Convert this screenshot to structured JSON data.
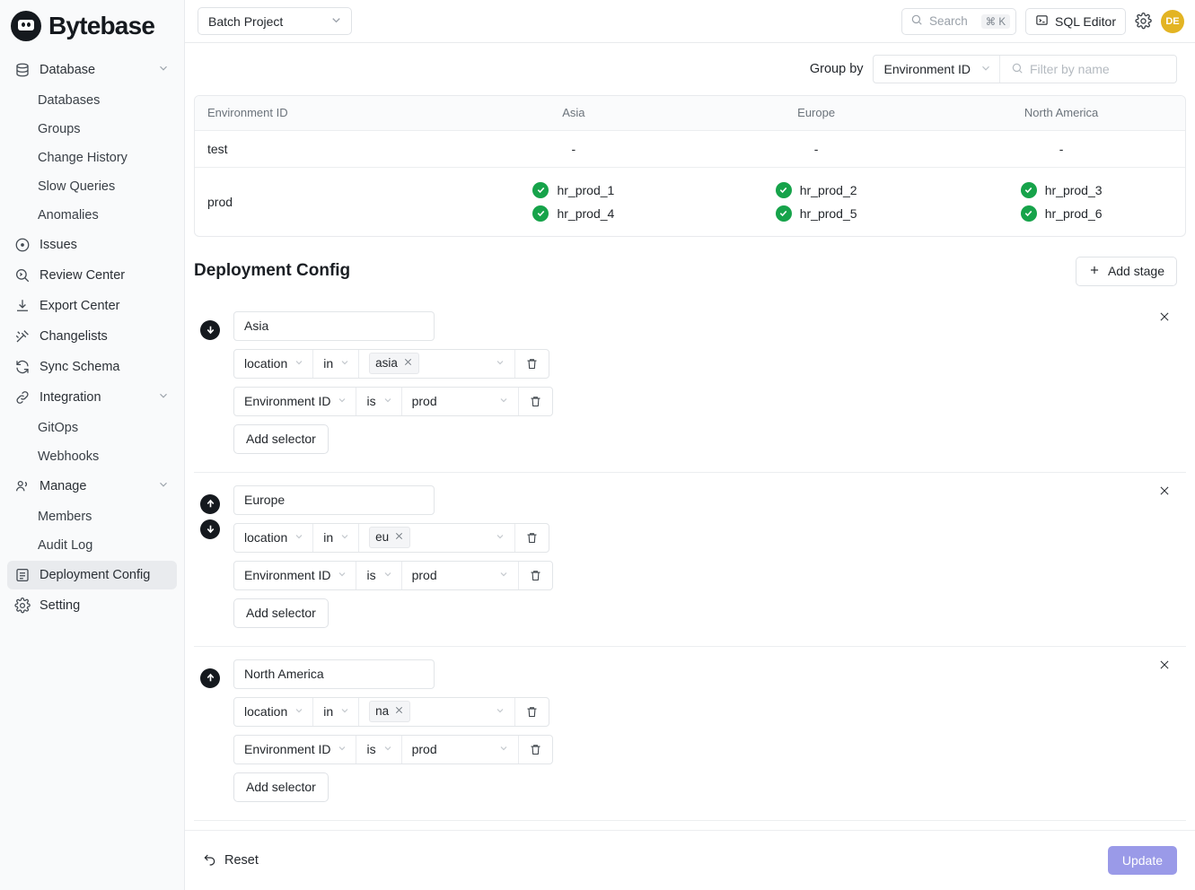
{
  "brand": {
    "name": "Bytebase"
  },
  "sidebar": {
    "items": [
      {
        "label": "Database",
        "icon": "database-icon",
        "type": "group",
        "expandable": true
      },
      {
        "label": "Databases",
        "type": "sub"
      },
      {
        "label": "Groups",
        "type": "sub"
      },
      {
        "label": "Change History",
        "type": "sub"
      },
      {
        "label": "Slow Queries",
        "type": "sub"
      },
      {
        "label": "Anomalies",
        "type": "sub"
      },
      {
        "label": "Issues",
        "icon": "issues-icon",
        "type": "item"
      },
      {
        "label": "Review Center",
        "icon": "review-icon",
        "type": "item"
      },
      {
        "label": "Export Center",
        "icon": "export-icon",
        "type": "item"
      },
      {
        "label": "Changelists",
        "icon": "changelists-icon",
        "type": "item"
      },
      {
        "label": "Sync Schema",
        "icon": "sync-icon",
        "type": "item"
      },
      {
        "label": "Integration",
        "icon": "link-icon",
        "type": "group",
        "expandable": true
      },
      {
        "label": "GitOps",
        "type": "sub"
      },
      {
        "label": "Webhooks",
        "type": "sub"
      },
      {
        "label": "Manage",
        "icon": "users-icon",
        "type": "group",
        "expandable": true
      },
      {
        "label": "Members",
        "type": "sub"
      },
      {
        "label": "Audit Log",
        "type": "sub"
      },
      {
        "label": "Deployment Config",
        "icon": "deployment-icon",
        "type": "item",
        "active": true
      },
      {
        "label": "Setting",
        "icon": "gear-icon",
        "type": "item"
      }
    ]
  },
  "topbar": {
    "project": "Batch Project",
    "search_placeholder": "Search",
    "search_shortcut": "⌘ K",
    "sql_editor": "SQL Editor",
    "avatar_initials": "DE"
  },
  "toolbar": {
    "group_by_label": "Group by",
    "group_by_value": "Environment ID",
    "filter_placeholder": "Filter by name"
  },
  "table": {
    "columns": [
      "Environment ID",
      "Asia",
      "Europe",
      "North America"
    ],
    "rows": [
      {
        "env": "test",
        "cells": [
          [],
          [],
          []
        ],
        "empty_mark": "-"
      },
      {
        "env": "prod",
        "cells": [
          [
            {
              "name": "hr_prod_1",
              "status": "ok"
            },
            {
              "name": "hr_prod_4",
              "status": "ok"
            }
          ],
          [
            {
              "name": "hr_prod_2",
              "status": "ok"
            },
            {
              "name": "hr_prod_5",
              "status": "ok"
            }
          ],
          [
            {
              "name": "hr_prod_3",
              "status": "ok"
            },
            {
              "name": "hr_prod_6",
              "status": "ok"
            }
          ]
        ]
      }
    ]
  },
  "deployment": {
    "title": "Deployment Config",
    "add_stage_label": "Add stage",
    "add_selector_label": "Add selector",
    "stages": [
      {
        "name": "Asia",
        "move_up": false,
        "move_down": true,
        "selectors": [
          {
            "key": "location",
            "operator": "in",
            "values": [
              "asia"
            ],
            "multi": true
          },
          {
            "key": "Environment ID",
            "operator": "is",
            "value": "prod",
            "multi": false
          }
        ]
      },
      {
        "name": "Europe",
        "move_up": true,
        "move_down": true,
        "selectors": [
          {
            "key": "location",
            "operator": "in",
            "values": [
              "eu"
            ],
            "multi": true
          },
          {
            "key": "Environment ID",
            "operator": "is",
            "value": "prod",
            "multi": false
          }
        ]
      },
      {
        "name": "North America",
        "move_up": true,
        "move_down": false,
        "selectors": [
          {
            "key": "location",
            "operator": "in",
            "values": [
              "na"
            ],
            "multi": true
          },
          {
            "key": "Environment ID",
            "operator": "is",
            "value": "prod",
            "multi": false
          }
        ]
      }
    ]
  },
  "footer": {
    "reset_label": "Reset",
    "update_label": "Update"
  },
  "colors": {
    "status_ok": "#16a34a",
    "avatar_bg": "#e3b423",
    "primary_button": "#9a9ae8",
    "active_nav_bg": "#e9ebee"
  }
}
